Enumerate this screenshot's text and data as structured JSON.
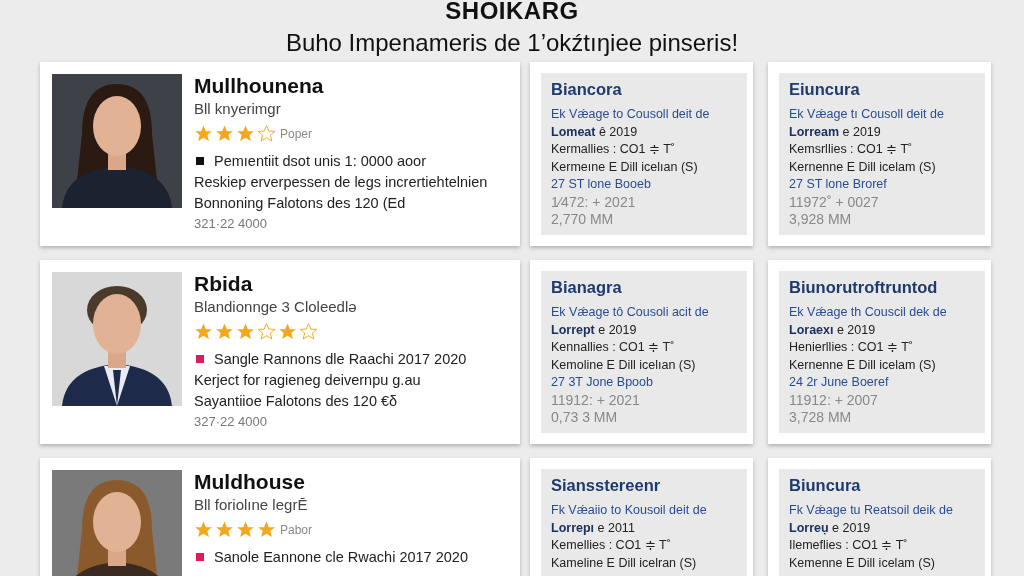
{
  "header": {
    "title": "SHOIKARG",
    "subtitle": "Buho Impenameris de  1’okźtıŋiee pinseris!"
  },
  "rows": [
    {
      "profile": {
        "name": "Mullhounena",
        "role": "Bll knyerimgr",
        "stars": [
          true,
          true,
          true,
          false
        ],
        "rating_label": "Poper",
        "bullet": {
          "color": "#111111",
          "text": "Pemıentiit dsot unis 1: 0000 aoor"
        },
        "lines": [
          "Reskiep erverpessen de legs incrertiehtelnien",
          "Bonnoning Falotons des 120 (Ed"
        ],
        "phone": "321·22 4000"
      },
      "details": [
        {
          "title": "Biancora",
          "lines": [
            {
              "kind": "link",
              "text": "Ek Vǽage to Cousoll deit de"
            },
            {
              "kind": "plain",
              "text": "**Lomeat** ȇ 2019"
            },
            {
              "kind": "plain",
              "text": "Kermallies : CO1 ≑ T˚"
            },
            {
              "kind": "plain",
              "text": "Kermeıne E Dill icelıan (S)"
            },
            {
              "kind": "link",
              "text": "27 ST lone Booeb"
            },
            {
              "kind": "muted",
              "text": "1⁄472: + 2021"
            },
            {
              "kind": "muted",
              "text": "2,770 MM"
            }
          ]
        },
        {
          "title": "Eiuncura",
          "lines": [
            {
              "kind": "link",
              "text": "Ek Vǽage tı Cousoll deit de"
            },
            {
              "kind": "plain",
              "text": "**Lorream** e 2019"
            },
            {
              "kind": "plain",
              "text": "Kemsrllies : CO1 ≑ T˚"
            },
            {
              "kind": "plain",
              "text": "Kernenne E Dill icelam (S)"
            },
            {
              "kind": "link",
              "text": "27 ST lone Broref"
            },
            {
              "kind": "muted",
              "text": "11972˚ + 0027"
            },
            {
              "kind": "muted",
              "text": "3,928 MM"
            }
          ]
        }
      ]
    },
    {
      "profile": {
        "name": "Rbida",
        "role": "Blandionnge 3 Cloleedlə",
        "stars": [
          true,
          true,
          true,
          false,
          true,
          false
        ],
        "bullet": {
          "color": "#e0185c",
          "text": "Sangle Rannons dle Raachi 2017 2020"
        },
        "lines": [
          "Kerject for ragieneg deivernpu g.au",
          "Sayantiioe Falotons des 120 €δ"
        ],
        "phone": "327·22 4000"
      },
      "details": [
        {
          "title": "Bianagra",
          "lines": [
            {
              "kind": "link",
              "text": "Ek Vǽage tô Cousoli acit de"
            },
            {
              "kind": "plain",
              "text": "**Lorrept** e 2019"
            },
            {
              "kind": "plain",
              "text": "Kennallies : CO1 ≑ T˚"
            },
            {
              "kind": "plain",
              "text": "Kemoline E Dill icelıan (S)"
            },
            {
              "kind": "link",
              "text": "27 3T Jone Bpoob"
            },
            {
              "kind": "muted",
              "text": "11912: + 2021"
            },
            {
              "kind": "muted",
              "text": "0,73 3 MM"
            }
          ]
        },
        {
          "title": "Biunorutroftruntod",
          "lines": [
            {
              "kind": "link",
              "text": "Ek Vǽage th Couscil dek de"
            },
            {
              "kind": "plain",
              "text": "**Loraexı** e 2019"
            },
            {
              "kind": "plain",
              "text": "Henierllies : CO1 ≑ T˚"
            },
            {
              "kind": "plain",
              "text": "Kernenne E Dill icelam (S)"
            },
            {
              "kind": "link",
              "text": "24 2r June Boeref"
            },
            {
              "kind": "muted",
              "text": "11912: + 2007"
            },
            {
              "kind": "muted",
              "text": "3,728 MM"
            }
          ]
        }
      ]
    },
    {
      "profile": {
        "name": "Muldhouse",
        "role": "Bll foriolıne legrĒ",
        "stars": [
          true,
          true,
          true,
          true
        ],
        "rating_label": "Pabor",
        "bullet": {
          "color": "#e0185c",
          "text": "Sanole Eannone cle Rwachi 2017 2020"
        }
      },
      "details": [
        {
          "title": "Siansstereenr",
          "lines": [
            {
              "kind": "link",
              "text": "Fk Vǽaiio to Kousoil deit de"
            },
            {
              "kind": "plain",
              "text": "**Lorrepı** e 2011"
            },
            {
              "kind": "plain",
              "text": "Kemellies : CO1 ≑ T˚"
            },
            {
              "kind": "plain",
              "text": "Kameline E Dill icelran (S)"
            }
          ]
        },
        {
          "title": "Biuncura",
          "lines": [
            {
              "kind": "link",
              "text": "Fk Vǽage tu Reatsoil deik de"
            },
            {
              "kind": "plain",
              "text": "**Lorreụ** e 2019"
            },
            {
              "kind": "plain",
              "text": "Ilemeflies : CO1 ≑ T˚"
            },
            {
              "kind": "plain",
              "text": "Kemenne E Dill icelam (S)"
            }
          ]
        }
      ]
    }
  ]
}
